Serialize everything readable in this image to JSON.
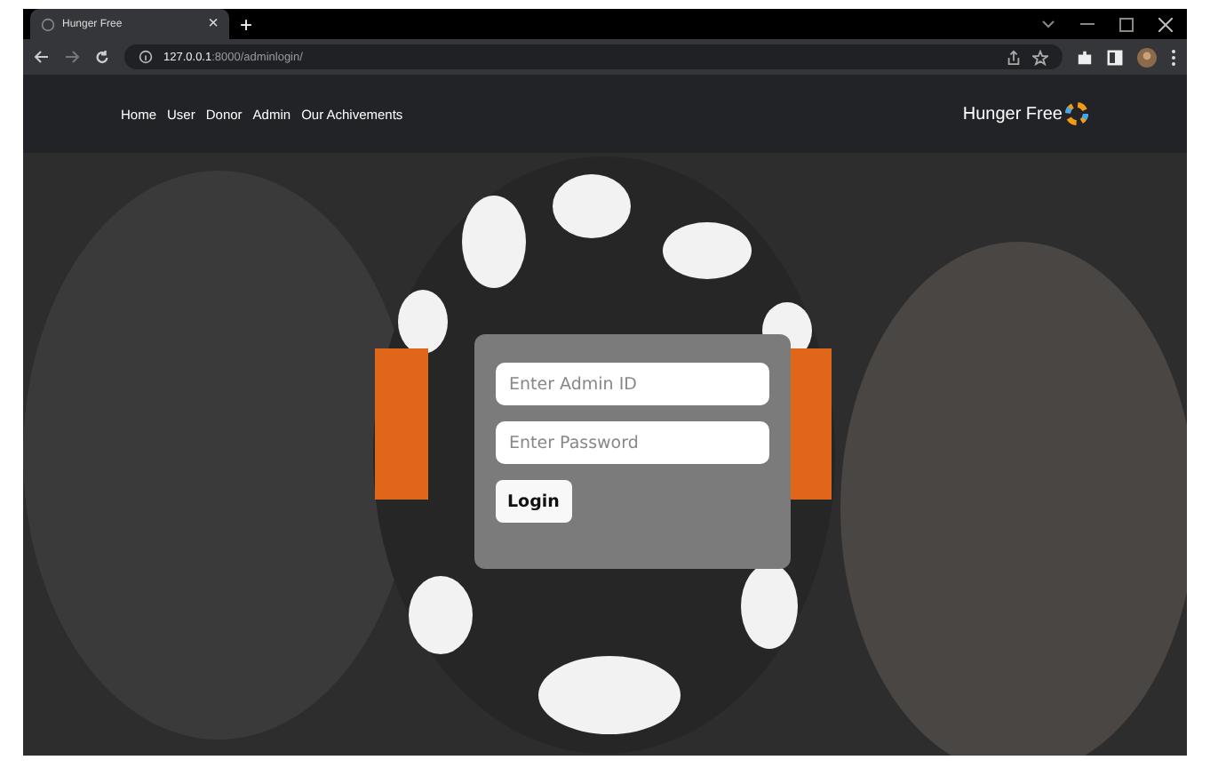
{
  "browser": {
    "tab_title": "Hunger Free",
    "tab_close": "×",
    "new_tab": "+",
    "url_host": "127.0.0.1",
    "url_path": ":8000/adminlogin/"
  },
  "nav": {
    "links": [
      "Home",
      "User",
      "Donor",
      "Admin",
      "Our Achivements"
    ],
    "brand": "Hunger Free"
  },
  "login": {
    "fields": [
      {
        "placeholder": "Enter Admin ID"
      },
      {
        "placeholder": "Enter Password"
      }
    ],
    "button": "Login"
  }
}
